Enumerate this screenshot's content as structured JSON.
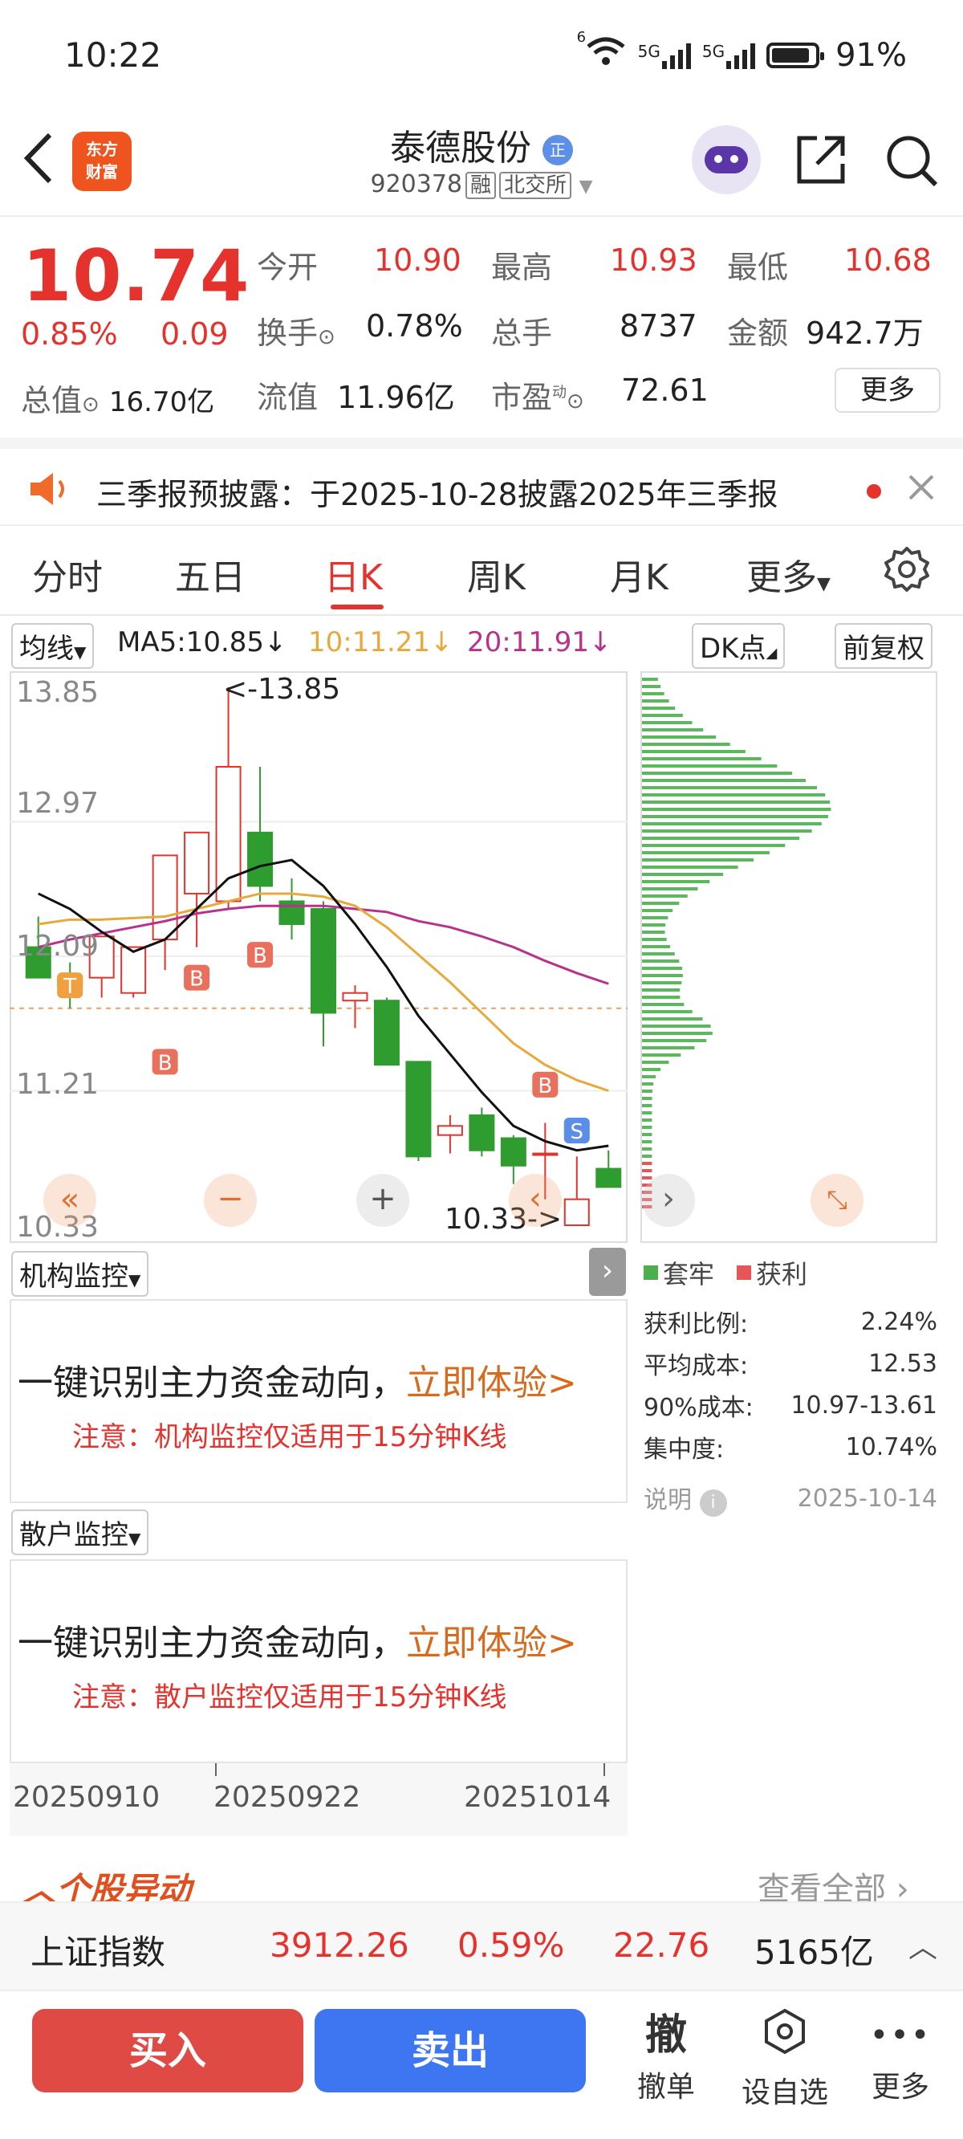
{
  "status": {
    "time": "10:22",
    "battery": "91%",
    "net1": "5G",
    "net2": "5G",
    "wifi_tag": "6"
  },
  "header": {
    "logo_line1": "东方",
    "logo_line2": "财富",
    "stock_name": "泰德股份",
    "badge": "正",
    "code": "920378",
    "tag1": "融",
    "tag2": "北交所"
  },
  "quote": {
    "price": "10.74",
    "change_pct": "0.85%",
    "change_abs": "0.09",
    "open_label": "今开",
    "open": "10.90",
    "high_label": "最高",
    "high": "10.93",
    "low_label": "最低",
    "low": "10.68",
    "turnover_label": "换手",
    "turnover": "0.78%",
    "volume_label": "总手",
    "volume": "8737",
    "amount_label": "金额",
    "amount": "942.7万",
    "mktcap_label": "总值",
    "mktcap": "16.70亿",
    "float_label": "流值",
    "float": "11.96亿",
    "pe_label": "市盈",
    "pe_sup": "动",
    "pe": "72.61",
    "more": "更多"
  },
  "notice": {
    "text": "三季报预披露：于2025-10-28披露2025年三季报"
  },
  "tabs": [
    "分时",
    "五日",
    "日K",
    "周K",
    "月K",
    "更多"
  ],
  "chart_toolbar": {
    "indicator": "均线",
    "ma5": "MA5:10.85↓",
    "ma10": "10:11.21↓",
    "ma20": "20:11.91↓",
    "dk": "DK点",
    "adjust": "前复权"
  },
  "chart_data": {
    "type": "candlestick",
    "y_ticks": [
      "13.85",
      "12.97",
      "12.09",
      "11.21",
      "10.33"
    ],
    "ylim": [
      10.33,
      13.85
    ],
    "high_marker": "<-13.85",
    "low_marker": "10.33->",
    "candles": [
      {
        "o": 12.15,
        "h": 12.35,
        "l": 11.95,
        "c": 11.95
      },
      {
        "o": 11.95,
        "h": 12.05,
        "l": 11.75,
        "c": 11.9
      },
      {
        "o": 11.95,
        "h": 12.05,
        "l": 11.82,
        "c": 12.22
      },
      {
        "o": 11.85,
        "h": 12.15,
        "l": 11.82,
        "c": 12.15
      },
      {
        "o": 12.2,
        "h": 12.75,
        "l": 12.0,
        "c": 12.75
      },
      {
        "o": 12.5,
        "h": 12.85,
        "l": 12.15,
        "c": 12.9
      },
      {
        "o": 12.45,
        "h": 13.85,
        "l": 12.4,
        "c": 13.33
      },
      {
        "o": 12.9,
        "h": 13.33,
        "l": 12.45,
        "c": 12.55
      },
      {
        "o": 12.45,
        "h": 12.6,
        "l": 12.2,
        "c": 12.3
      },
      {
        "o": 12.4,
        "h": 12.45,
        "l": 11.5,
        "c": 11.72
      },
      {
        "o": 11.8,
        "h": 11.9,
        "l": 11.62,
        "c": 11.85
      },
      {
        "o": 11.8,
        "h": 11.82,
        "l": 11.38,
        "c": 11.38
      },
      {
        "o": 11.4,
        "h": 11.4,
        "l": 10.75,
        "c": 10.78
      },
      {
        "o": 10.92,
        "h": 11.05,
        "l": 10.8,
        "c": 10.98
      },
      {
        "o": 11.05,
        "h": 11.1,
        "l": 10.78,
        "c": 10.82
      },
      {
        "o": 10.9,
        "h": 10.92,
        "l": 10.6,
        "c": 10.72
      },
      {
        "o": 10.8,
        "h": 11.0,
        "l": 10.5,
        "c": 10.8
      },
      {
        "o": 10.33,
        "h": 10.78,
        "l": 10.33,
        "c": 10.5
      },
      {
        "o": 10.7,
        "h": 10.82,
        "l": 10.58,
        "c": 10.58
      }
    ],
    "ma5": [
      12.5,
      12.4,
      12.25,
      12.12,
      12.2,
      12.4,
      12.6,
      12.68,
      12.72,
      12.55,
      12.3,
      12.02,
      11.7,
      11.45,
      11.2,
      10.98,
      10.88,
      10.82,
      10.85
    ],
    "ma10": [
      12.3,
      12.33,
      12.33,
      12.34,
      12.35,
      12.4,
      12.45,
      12.5,
      12.5,
      12.48,
      12.42,
      12.28,
      12.1,
      11.92,
      11.72,
      11.52,
      11.38,
      11.28,
      11.21
    ],
    "ma20": [
      12.15,
      12.2,
      12.24,
      12.28,
      12.32,
      12.37,
      12.4,
      12.42,
      12.42,
      12.42,
      12.4,
      12.38,
      12.32,
      12.28,
      12.22,
      12.15,
      12.06,
      11.98,
      11.91
    ],
    "signals": [
      "T",
      "B",
      "B",
      "B",
      "B",
      "S"
    ],
    "x_labels": [
      "20250910",
      "20250922",
      "20251014"
    ],
    "chip_legend_trapped": "套牢",
    "chip_legend_profit": "获利"
  },
  "chip_stats": {
    "profit_ratio_label": "获利比例:",
    "profit_ratio": "2.24%",
    "avg_cost_label": "平均成本:",
    "avg_cost": "12.53",
    "cost90_label": "90%成本:",
    "cost90": "10.97-13.61",
    "concentration_label": "集中度:",
    "concentration": "10.74%",
    "note_label": "说明",
    "date": "2025-10-14"
  },
  "panels": [
    {
      "title": "机构监控",
      "cta_prefix": "一键识别主力资金动向，",
      "cta_link": "立即体验>",
      "note": "注意：机构监控仅适用于15分钟K线"
    },
    {
      "title": "散户监控",
      "cta_prefix": "一键识别主力资金动向，",
      "cta_link": "立即体验>",
      "note": "注意：散户监控仅适用于15分钟K线"
    }
  ],
  "section": {
    "title": "个股异动",
    "view_all": "查看全部"
  },
  "index_bar": {
    "name": "上证指数",
    "value": "3912.26",
    "pct": "0.59%",
    "change": "22.76",
    "amount": "5165亿"
  },
  "trade": {
    "buy": "买入",
    "sell": "卖出",
    "cancel_icon": "撤",
    "cancel": "撤单",
    "watch": "设自选",
    "more": "更多"
  }
}
